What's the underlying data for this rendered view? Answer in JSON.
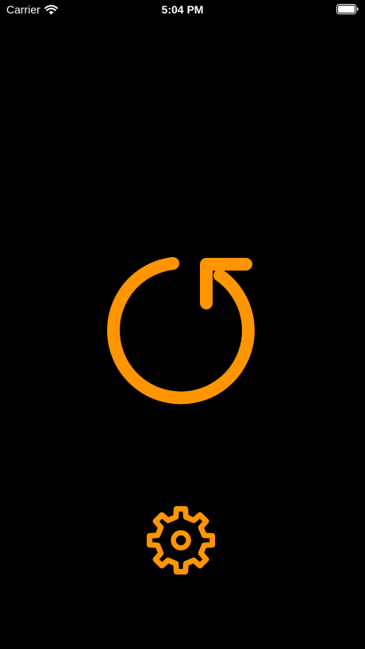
{
  "status_bar": {
    "carrier": "Carrier",
    "time": "5:04 PM",
    "wifi_icon": "wifi-icon",
    "battery_icon": "battery-full-icon"
  },
  "main": {
    "reset_icon": "counterclockwise-arrow-icon",
    "settings_icon": "gear-icon"
  },
  "colors": {
    "background": "#000000",
    "accent": "#FF9500",
    "status_text": "#FFFFFF"
  }
}
